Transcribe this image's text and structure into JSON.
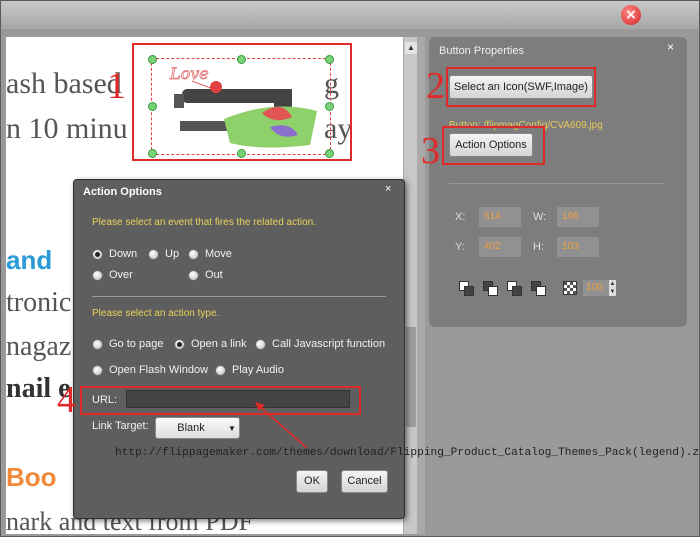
{
  "canvas": {
    "lines": [
      "ash based",
      "n 10 minu",
      "and",
      "tronic",
      "nagaz",
      "nail e",
      "Boo",
      "nark and text from PDF"
    ]
  },
  "canvas_right_text": [
    "g",
    "ay"
  ],
  "button_properties": {
    "title": "Button Properties",
    "close": "×",
    "select_icon_label": "Select an Icon(SWF,Image)",
    "path": "Button: /flipmagConfig/CVA609.jpg",
    "action_options_label": "Action Options",
    "x_label": "X:",
    "x_value": "614",
    "w_label": "W:",
    "w_value": "196",
    "y_label": "Y:",
    "y_value": "402",
    "h_label": "H:",
    "h_value": "103",
    "opacity_value": "100"
  },
  "dialog": {
    "title": "Action Options",
    "close": "×",
    "event_hint": "Please select an event that fires the related action.",
    "events": [
      {
        "label": "Down",
        "selected": true
      },
      {
        "label": "Up",
        "selected": false
      },
      {
        "label": "Move",
        "selected": false
      },
      {
        "label": "Over",
        "selected": false
      },
      {
        "label": "Out",
        "selected": false
      }
    ],
    "action_hint": "Please select an action type.",
    "actions": [
      {
        "label": "Go to page",
        "selected": false
      },
      {
        "label": "Open a link",
        "selected": true
      },
      {
        "label": "Call Javascript function",
        "selected": false
      },
      {
        "label": "Open Flash Window",
        "selected": false
      },
      {
        "label": "Play Audio",
        "selected": false
      }
    ],
    "url_label": "URL:",
    "url_value": "",
    "link_target_label": "Link Target:",
    "link_target_value": "Blank",
    "ok_label": "OK",
    "cancel_label": "Cancel"
  },
  "annotation": {
    "url_text": "http://flippagemaker.com/themes/download/Flipping_Product_Catalog_Themes_Pack(legend).zip",
    "numbers": [
      "1",
      "2",
      "3",
      "4"
    ],
    "color": "#e02a2a"
  },
  "colors": {
    "hint": "#e8d25a",
    "accent_blue": "#2a9ad6",
    "accent_orange": "#f08a3a"
  }
}
